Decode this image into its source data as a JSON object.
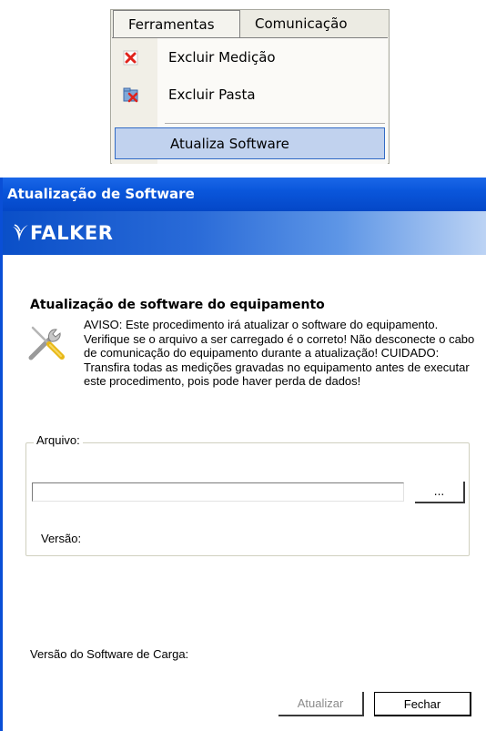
{
  "menu": {
    "bar_items": [
      "Ferramentas",
      "Comunicação"
    ],
    "items": [
      {
        "label": "Excluir Medição",
        "icon": "delete-icon"
      },
      {
        "label": "Excluir Pasta",
        "icon": "delete-folder-icon"
      },
      {
        "label": "Atualiza Software",
        "highlighted": true
      }
    ]
  },
  "dialog": {
    "title": "Atualização de Software",
    "brand": "FALKER",
    "heading": "Atualização de software do equipamento",
    "warning": "AVISO: Este procedimento irá atualizar o software do equipamento. Verifique se o arquivo a ser carregado é o correto! Não desconecte o cabo de comunicação do equipamento durante a atualização! CUIDADO: Transfira todas as medições gravadas no equipamento antes de executar este procedimento, pois pode haver perda de dados!",
    "file_group": {
      "legend": "Arquivo:",
      "file_value": "",
      "browse_label": "...",
      "version_label": "Versão:"
    },
    "carga_label": "Versão do Software de Carga:",
    "buttons": {
      "update": "Atualizar",
      "close": "Fechar"
    },
    "colors": {
      "titlebar": "#0a56db",
      "menu_highlight": "#c1d2ee"
    }
  }
}
